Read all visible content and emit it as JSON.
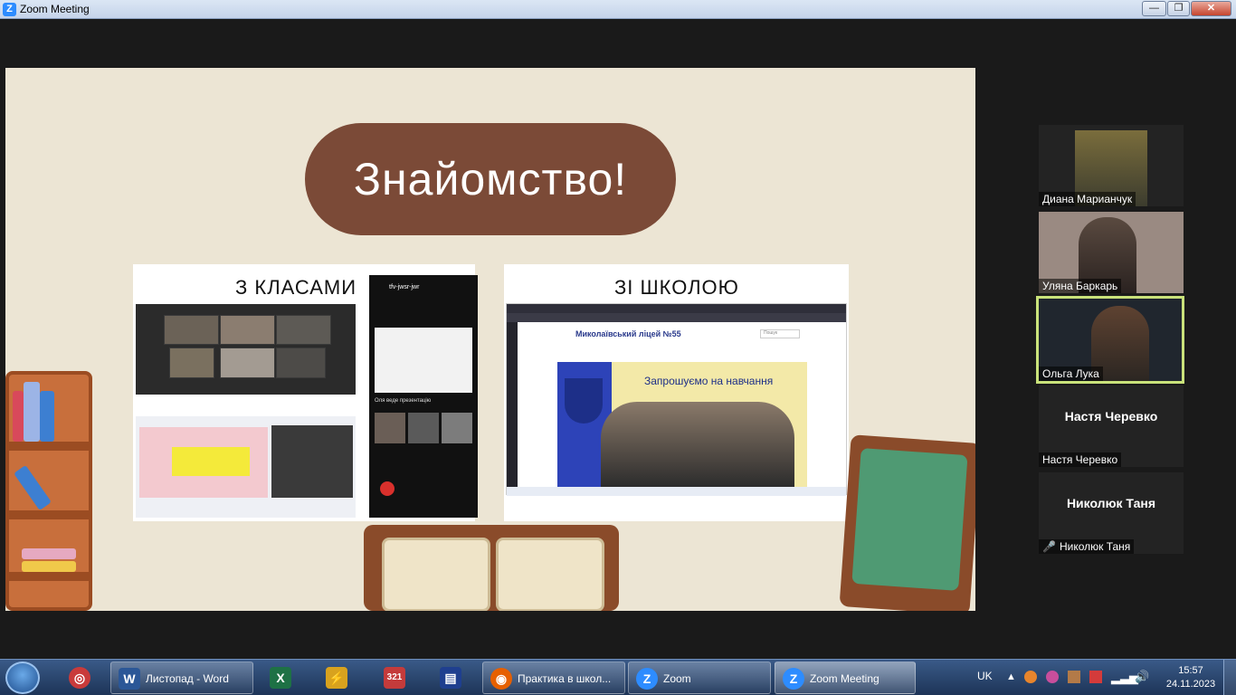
{
  "window": {
    "title": "Zoom Meeting",
    "app_icon": "Z",
    "minimize": "—",
    "maximize": "❐",
    "close": "✕"
  },
  "slide": {
    "title": "Знайомство!",
    "left_card_label": "З КЛАСАМИ",
    "right_card_label": "ЗІ ШКОЛОЮ",
    "school_site": {
      "name": "Миколаївський ліцей №55",
      "banner": "Запрошуємо на навчання",
      "search": "Пошук"
    },
    "phone": {
      "meeting_id": "tfv-jwsr-jwr",
      "note": "Оля веде презентацію"
    }
  },
  "participants": [
    {
      "name": "Диана Марианчук",
      "video": true,
      "muted": false,
      "active": false
    },
    {
      "name": "Уляна Баркарь",
      "video": true,
      "muted": false,
      "active": false
    },
    {
      "name": "Ольга Лука",
      "video": true,
      "muted": false,
      "active": true
    },
    {
      "name": "Настя Черевко",
      "video": false,
      "muted": false,
      "active": false
    },
    {
      "name": "Николюк Таня",
      "video": false,
      "muted": true,
      "active": false
    }
  ],
  "taskbar": {
    "items": [
      {
        "label": "Листопад - Word",
        "icon": "word-icon",
        "color": "#2b5797",
        "glyph": "W"
      },
      {
        "label": "",
        "icon": "excel-icon",
        "color": "#1e7145",
        "glyph": "X"
      },
      {
        "label": "",
        "icon": "tool-icon",
        "color": "#d8a21e",
        "glyph": "⚡"
      },
      {
        "label": "",
        "icon": "counter-icon",
        "color": "#c43b3b",
        "glyph": "321"
      },
      {
        "label": "",
        "icon": "save-icon",
        "color": "#1f3f8f",
        "glyph": "▤"
      },
      {
        "label": "Практика в школ...",
        "icon": "firefox-icon",
        "color": "#e66000",
        "glyph": "◉"
      },
      {
        "label": "Zoom",
        "icon": "zoom-icon",
        "color": "#2d8cff",
        "glyph": "Z"
      },
      {
        "label": "Zoom Meeting",
        "icon": "zoom-icon",
        "color": "#2d8cff",
        "glyph": "Z"
      }
    ],
    "language": "UK",
    "time": "15:57",
    "date": "24.11.2023"
  }
}
